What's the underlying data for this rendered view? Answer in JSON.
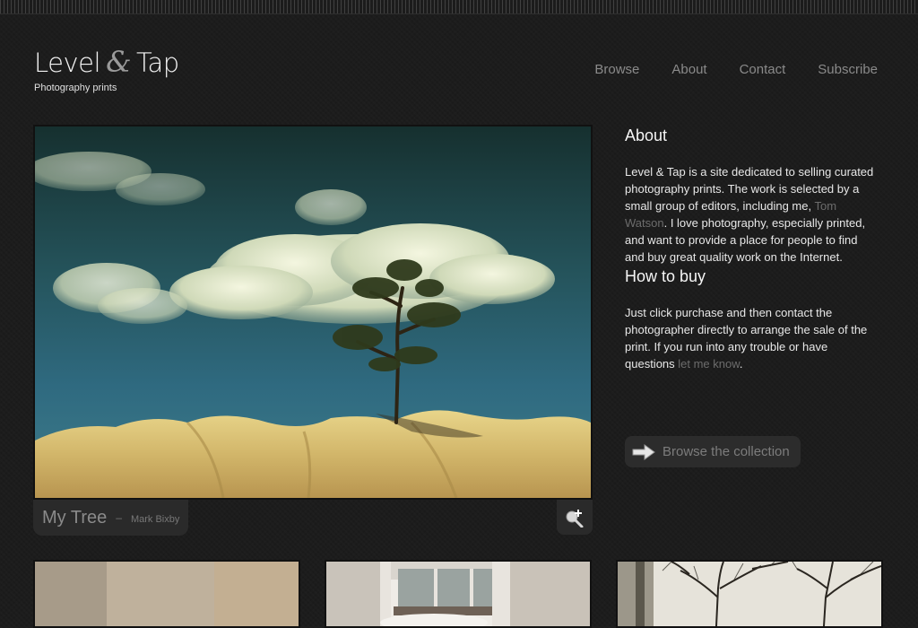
{
  "site": {
    "name_part1": "Level",
    "amp": "&",
    "name_part2": "Tap",
    "tagline": "Photography prints"
  },
  "nav": [
    {
      "label": "Browse"
    },
    {
      "label": "About"
    },
    {
      "label": "Contact"
    },
    {
      "label": "Subscribe"
    }
  ],
  "featured": {
    "title": "My Tree",
    "separator": "–",
    "author": "Mark Bixby"
  },
  "about": {
    "heading": "About",
    "text_before_link": "Level & Tap is a site dedicated to selling curated photography prints. The work is selected by a small group of editors, including me, ",
    "link": "Tom Watson",
    "text_after_link": ". I love photography, especially printed, and want to provide a place for people to find and buy great quality work on the Internet."
  },
  "how_to_buy": {
    "heading": "How to buy",
    "text_before_link": "Just click purchase and then contact the photographer directly to arrange the sale of the print. If you run into any trouble or have questions ",
    "link": "let me know",
    "text_after_link": "."
  },
  "browse_button": {
    "label": "Browse the collection",
    "icon": "arrow-right-icon"
  },
  "colors": {
    "background": "#1c1c1c",
    "link": "#6c6c6c",
    "nav": "#8a8a8a"
  }
}
